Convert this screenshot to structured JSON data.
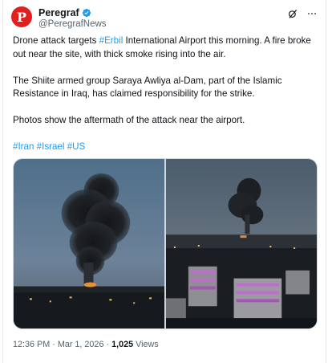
{
  "account": {
    "avatar_letter": "P",
    "display_name": "Peregraf",
    "handle": "@PeregrafNews",
    "verified": true
  },
  "actions": [
    "grok-icon",
    "more-icon"
  ],
  "tweet": {
    "para1_pre": "Drone attack targets ",
    "para1_link": "#Erbil",
    "para1_post": " International Airport this morning. A fire broke out near the site, with thick smoke rising into the air.",
    "para2": "The Shiite armed group Saraya Awliya al-Dam, part of the Islamic Resistance in Iraq, has claimed responsibility for the strike.",
    "para3": "Photos show the aftermath of the attack near the airport.",
    "hashtags": [
      "#Iran",
      "#Israel",
      "#US"
    ]
  },
  "meta": {
    "time": "12:36 PM",
    "separator": "·",
    "date": "Mar 1, 2026",
    "views_count": "1,025",
    "views_label": "Views"
  },
  "colors": {
    "link": "#1d9bf0",
    "avatar": "#e0201f",
    "verified": "#1d9bf0"
  }
}
